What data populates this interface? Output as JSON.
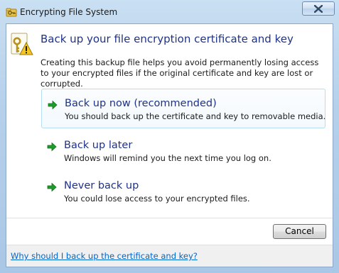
{
  "window": {
    "title": "Encrypting File System",
    "title_icon": "key-folder-icon",
    "close_icon": "close-icon"
  },
  "header": {
    "icon": "key-warning-icon",
    "title": "Back up your file encryption certificate and key",
    "description": "Creating this backup file helps you avoid permanently losing access to your encrypted files if the original certificate and key are lost or corrupted."
  },
  "options": [
    {
      "title": "Back up now (recommended)",
      "description": "You should back up the certificate and key to removable media.",
      "selected": true,
      "icon": "green-arrow-icon"
    },
    {
      "title": "Back up later",
      "description": "Windows will remind you the next time you log on.",
      "selected": false,
      "icon": "green-arrow-icon"
    },
    {
      "title": "Never back up",
      "description": "You could lose access to your encrypted files.",
      "selected": false,
      "icon": "green-arrow-icon"
    }
  ],
  "buttons": {
    "cancel_label": "Cancel"
  },
  "footer": {
    "help_link": "Why should I back up the certificate and key?"
  },
  "colors": {
    "instruction_text": "#1e3287",
    "link": "#0066cc",
    "arrow_green": "#1f9d2a",
    "selected_border": "#b5dff0"
  }
}
